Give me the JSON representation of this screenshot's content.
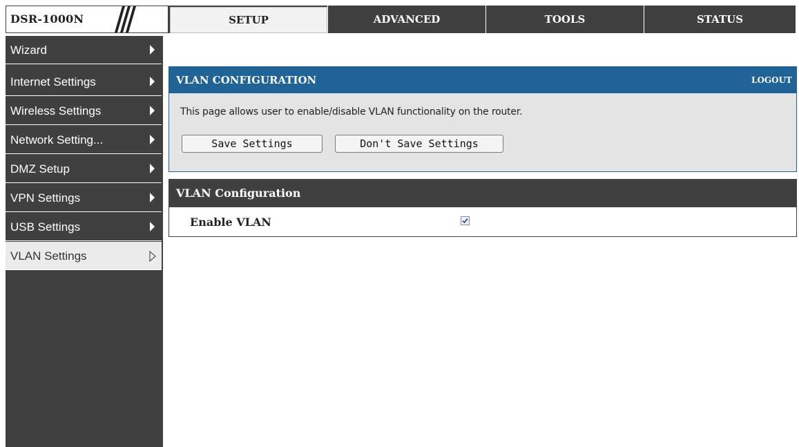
{
  "brand": {
    "label": "DSR-1000N"
  },
  "tabs": [
    {
      "label": "SETUP",
      "active": true
    },
    {
      "label": "ADVANCED",
      "active": false
    },
    {
      "label": "TOOLS",
      "active": false
    },
    {
      "label": "STATUS",
      "active": false
    }
  ],
  "sidebar": {
    "items": [
      {
        "label": "Wizard"
      },
      {
        "label": "Internet Settings"
      },
      {
        "label": "Wireless Settings"
      },
      {
        "label": "Network Setting..."
      },
      {
        "label": "DMZ Setup"
      },
      {
        "label": "VPN Settings"
      },
      {
        "label": "USB Settings"
      },
      {
        "label": "VLAN Settings",
        "active": true
      }
    ]
  },
  "config": {
    "title": "VLAN CONFIGURATION",
    "logout": "LOGOUT",
    "description": "This page allows user to enable/disable VLAN functionality on the router.",
    "save_label": "Save Settings",
    "dont_save_label": "Don't Save Settings"
  },
  "vlan": {
    "section_title": "VLAN Configuration",
    "enable_label": "Enable VLAN",
    "enable_checked": true
  },
  "colors": {
    "header_blue": "#1f6397",
    "dark_gray": "#404040",
    "panel_gray": "#e4e4e4"
  },
  "icons": {
    "sidebar_arrow": "triangle-right-icon",
    "sidebar_arrow_active": "triangle-right-outline-icon",
    "checkbox": "checkbox-checked-icon"
  }
}
